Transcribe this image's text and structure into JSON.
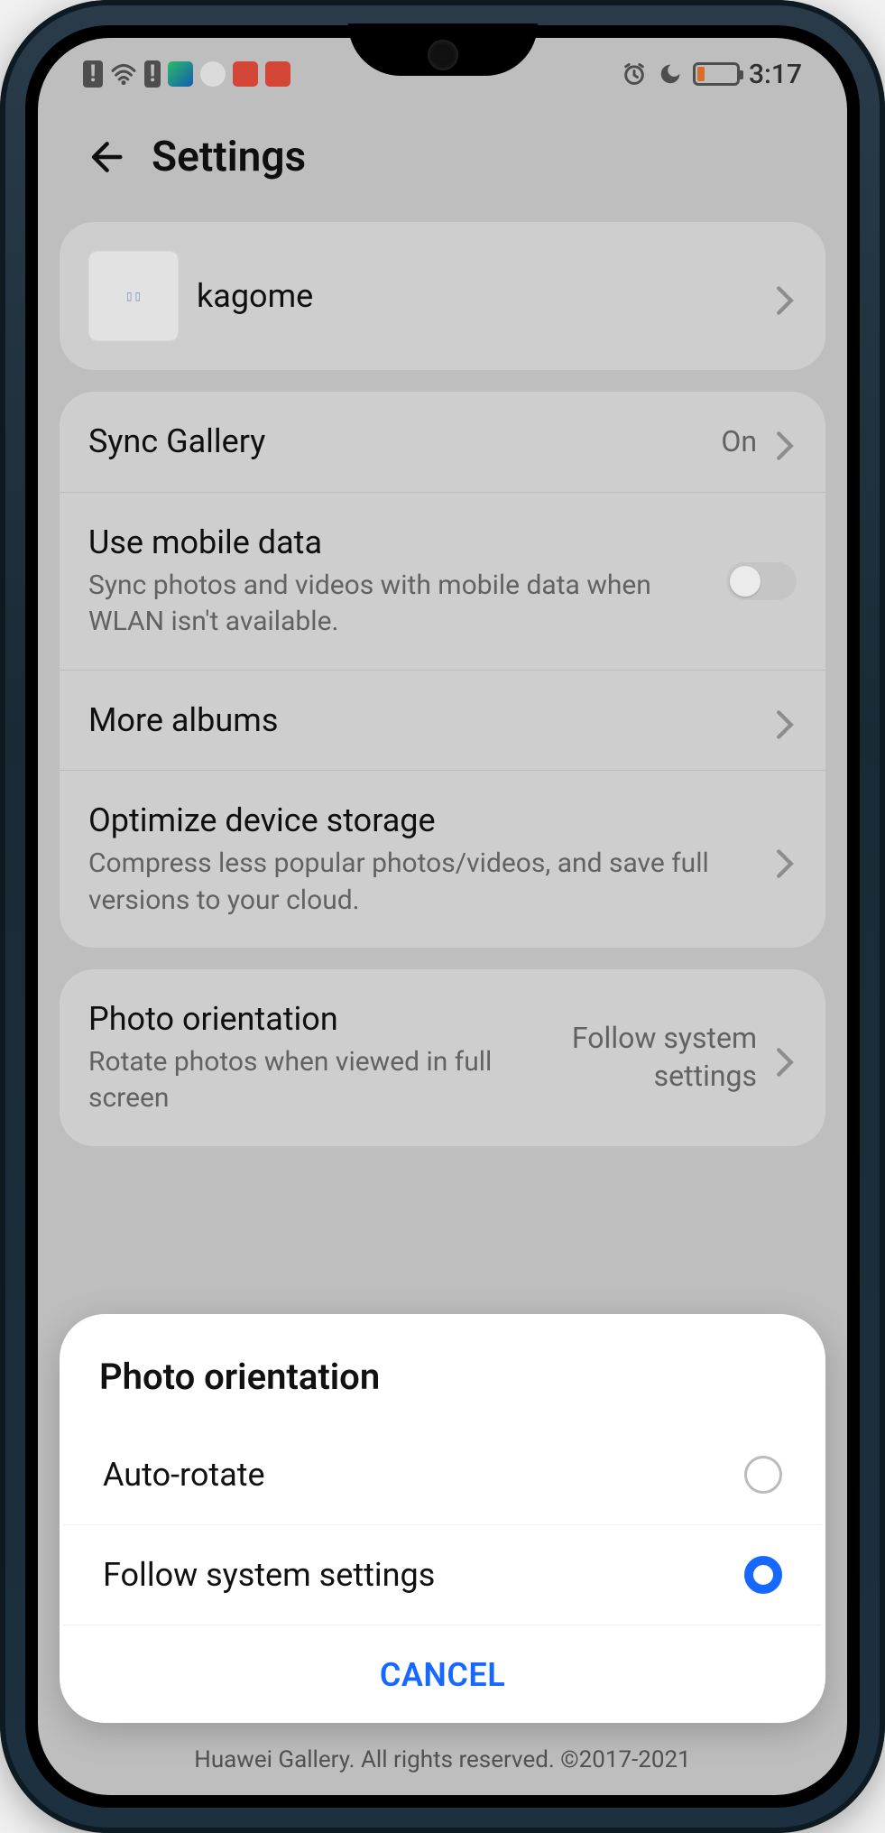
{
  "status": {
    "time": "3:17"
  },
  "header": {
    "title": "Settings"
  },
  "account": {
    "name": "kagome"
  },
  "settings": {
    "sync_gallery": {
      "label": "Sync Gallery",
      "value": "On"
    },
    "mobile_data": {
      "label": "Use mobile data",
      "sub": "Sync photos and videos with mobile data when WLAN isn't available."
    },
    "more_albums": {
      "label": "More albums"
    },
    "optimize": {
      "label": "Optimize device storage",
      "sub": "Compress less popular photos/videos, and save full versions to your cloud."
    },
    "orientation": {
      "label": "Photo orientation",
      "sub": "Rotate photos when viewed in full screen",
      "value": "Follow system settings"
    }
  },
  "dialog": {
    "title": "Photo orientation",
    "options": [
      {
        "label": "Auto-rotate",
        "selected": false
      },
      {
        "label": "Follow system settings",
        "selected": true
      }
    ],
    "cancel": "CANCEL"
  },
  "footer": "Huawei Gallery. All rights reserved. ©2017-2021"
}
